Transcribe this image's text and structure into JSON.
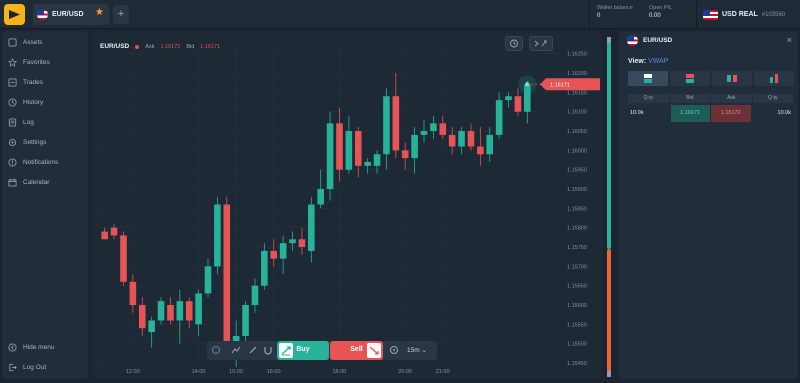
{
  "topbar": {
    "pair_tab": "EUR/USD",
    "add_tab": "+",
    "wallet_label": "Wallet balance",
    "wallet_value": "0",
    "openpl_label": "Open P/L",
    "openpl_value": "0.00",
    "account_currency": "USD REAL",
    "account_id": "#103560"
  },
  "sidebar": {
    "items": [
      {
        "label": "Assets",
        "icon": "assets-icon"
      },
      {
        "label": "Favorites",
        "icon": "star-icon"
      },
      {
        "label": "Trades",
        "icon": "trades-icon"
      },
      {
        "label": "History",
        "icon": "history-icon"
      },
      {
        "label": "Log",
        "icon": "log-icon"
      },
      {
        "label": "Settings",
        "icon": "gear-icon"
      },
      {
        "label": "Notifications",
        "icon": "bell-icon"
      },
      {
        "label": "Calendar",
        "icon": "calendar-icon"
      }
    ],
    "hide_menu": "Hide menu",
    "log_out": "Log Out"
  },
  "chart": {
    "symbol": "EUR/USD",
    "ask_label": "Ask",
    "ask_value": "1.16172",
    "bid_label": "Bid",
    "bid_value": "1.16171",
    "current_price": "1.16171",
    "timeframe": "15m",
    "buy_label": "Buy",
    "sell_label": "Sell"
  },
  "chart_data": {
    "type": "candlestick",
    "y_ticks": [
      "1.16250",
      "1.16200",
      "1.16150",
      "1.16100",
      "1.16050",
      "1.16000",
      "1.15950",
      "1.15900",
      "1.15850",
      "1.15800",
      "1.15750",
      "1.15700",
      "1.15650",
      "1.15600",
      "1.15550",
      "1.15500",
      "1.15450"
    ],
    "x_ticks": [
      "12:00",
      "14:00",
      "15:00",
      "16:00",
      "18:00",
      "20:00",
      "21:00"
    ],
    "ylim": [
      1.1545,
      1.1627
    ],
    "candles": [
      [
        1.1579,
        1.158,
        1.1578,
        1.1577
      ],
      [
        1.158,
        1.1581,
        1.1577,
        1.1578
      ],
      [
        1.1578,
        1.1579,
        1.1565,
        1.1566
      ],
      [
        1.1566,
        1.1568,
        1.1558,
        1.156
      ],
      [
        1.156,
        1.1562,
        1.1552,
        1.1554
      ],
      [
        1.1553,
        1.1557,
        1.1549,
        1.1556
      ],
      [
        1.1556,
        1.1562,
        1.1555,
        1.1561
      ],
      [
        1.156,
        1.1562,
        1.1555,
        1.1556
      ],
      [
        1.1556,
        1.1564,
        1.155,
        1.1561
      ],
      [
        1.1561,
        1.1562,
        1.1554,
        1.1556
      ],
      [
        1.1555,
        1.1564,
        1.1552,
        1.1563
      ],
      [
        1.1563,
        1.1572,
        1.1562,
        1.157
      ],
      [
        1.157,
        1.1588,
        1.1568,
        1.1586
      ],
      [
        1.1586,
        1.1588,
        1.1546,
        1.1548
      ],
      [
        1.1548,
        1.1556,
        1.1544,
        1.1552
      ],
      [
        1.1552,
        1.1561,
        1.155,
        1.156
      ],
      [
        1.156,
        1.1567,
        1.1558,
        1.1565
      ],
      [
        1.1565,
        1.1576,
        1.1564,
        1.1574
      ],
      [
        1.1574,
        1.1577,
        1.157,
        1.1572
      ],
      [
        1.1572,
        1.1578,
        1.1568,
        1.1576
      ],
      [
        1.1576,
        1.1579,
        1.1574,
        1.1577
      ],
      [
        1.1577,
        1.158,
        1.1573,
        1.1575
      ],
      [
        1.1574,
        1.1588,
        1.1571,
        1.1586
      ],
      [
        1.1586,
        1.1595,
        1.1585,
        1.159
      ],
      [
        1.159,
        1.161,
        1.1587,
        1.1607
      ],
      [
        1.1607,
        1.1611,
        1.1592,
        1.1595
      ],
      [
        1.1595,
        1.1609,
        1.1594,
        1.1605
      ],
      [
        1.1605,
        1.1606,
        1.1593,
        1.1596
      ],
      [
        1.1596,
        1.1598,
        1.1594,
        1.1597
      ],
      [
        1.1596,
        1.16,
        1.1594,
        1.1599
      ],
      [
        1.1599,
        1.1616,
        1.1595,
        1.1614
      ],
      [
        1.1614,
        1.162,
        1.1598,
        1.16
      ],
      [
        1.16,
        1.1602,
        1.1595,
        1.1598
      ],
      [
        1.1598,
        1.1606,
        1.1594,
        1.1604
      ],
      [
        1.1604,
        1.1608,
        1.1602,
        1.1605
      ],
      [
        1.1605,
        1.1609,
        1.1603,
        1.1607
      ],
      [
        1.1607,
        1.1609,
        1.1603,
        1.1604
      ],
      [
        1.1604,
        1.1606,
        1.1599,
        1.1601
      ],
      [
        1.1601,
        1.1606,
        1.1599,
        1.1605
      ],
      [
        1.1605,
        1.1607,
        1.16,
        1.1601
      ],
      [
        1.1601,
        1.1606,
        1.1596,
        1.1599
      ],
      [
        1.1599,
        1.1606,
        1.1597,
        1.1604
      ],
      [
        1.1604,
        1.1615,
        1.1603,
        1.1613
      ],
      [
        1.1613,
        1.1615,
        1.1611,
        1.1614
      ],
      [
        1.1614,
        1.1616,
        1.1609,
        1.161
      ],
      [
        1.161,
        1.1618,
        1.1607,
        1.16171
      ]
    ]
  },
  "right_panel": {
    "symbol": "EUR/USD",
    "view_label": "View:",
    "view_value": "VWAP",
    "orderbook": {
      "headers": [
        "Q-ty",
        "Bid",
        "Ask",
        "Q-ty"
      ],
      "row": [
        "10.0k",
        "1.16171",
        "1.16172",
        "10.0k"
      ]
    }
  },
  "colors": {
    "up": "#26b39a",
    "down": "#e65456",
    "accent": "#f4b41a"
  }
}
